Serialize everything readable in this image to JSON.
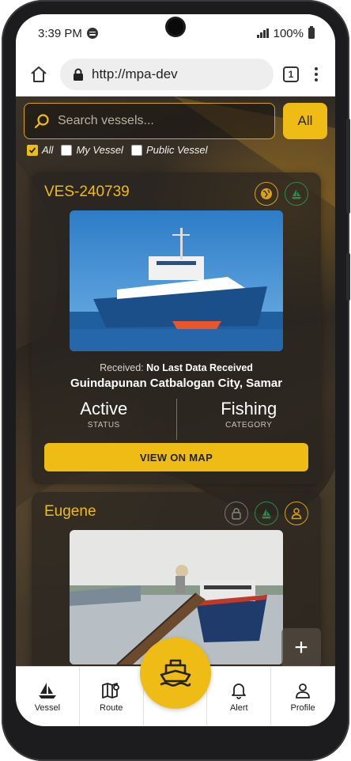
{
  "statusbar": {
    "time": "3:39 PM",
    "battery": "100%"
  },
  "browser": {
    "url": "http://mpa-dev",
    "tab_count": "1"
  },
  "search": {
    "placeholder": "Search vessels...",
    "all_label": "All"
  },
  "filters": [
    {
      "label": "All",
      "checked": true
    },
    {
      "label": "My Vessel",
      "checked": false
    },
    {
      "label": "Public Vessel",
      "checked": false
    }
  ],
  "vessels": [
    {
      "name": "VES-240739",
      "received_label": "Received:",
      "received_value": "No Last Data Received",
      "location": "Guindapunan Catbalogan City, Samar",
      "status_value": "Active",
      "status_label": "STATUS",
      "category_value": "Fishing",
      "category_label": "CATEGORY",
      "button_label": "VIEW ON MAP",
      "icons": [
        "globe-icon",
        "boat-icon"
      ]
    },
    {
      "name": "Eugene",
      "icons": [
        "lock-icon",
        "boat-icon",
        "user-icon"
      ]
    }
  ],
  "fab_add": "+",
  "nav": [
    {
      "label": "Vessel",
      "icon": "sailboat-icon"
    },
    {
      "label": "Route",
      "icon": "map-icon"
    },
    {
      "label": "Alert",
      "icon": "bell-icon"
    },
    {
      "label": "Profile",
      "icon": "user-icon"
    }
  ],
  "colors": {
    "accent": "#efbb15",
    "green": "#2d8a4e",
    "dark_bg": "#2a2520"
  }
}
